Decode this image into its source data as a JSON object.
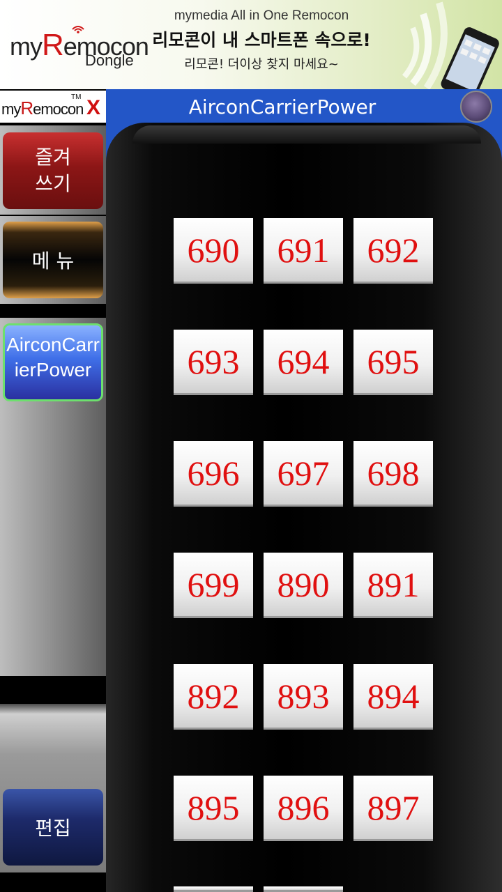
{
  "banner": {
    "logo_prefix": "my",
    "logo_r": "R",
    "logo_rest": "emocon",
    "logo_sub": "Dongle",
    "line1": "mymedia All in One Remocon",
    "line2": "리모콘이 내 스마트폰 속으로!",
    "line3": "리모콘! 더이상 찾지 마세요~"
  },
  "sidebar": {
    "logo_prefix": "my",
    "logo_r": "R",
    "logo_rest": "emocon",
    "logo_tm": "TM",
    "logo_x": "X",
    "favorites_label": "즐겨\n쓰기",
    "menu_label": "메 뉴",
    "current_label": "AirconCarrierPower",
    "edit_label": "편집"
  },
  "header": {
    "title": "AirconCarrierPower"
  },
  "keypad": {
    "rows": [
      [
        "690",
        "691",
        "692"
      ],
      [
        "693",
        "694",
        "695"
      ],
      [
        "696",
        "697",
        "698"
      ],
      [
        "699",
        "890",
        "891"
      ],
      [
        "892",
        "893",
        "894"
      ],
      [
        "895",
        "896",
        "897"
      ],
      [
        "",
        ""
      ]
    ]
  },
  "colors": {
    "header_blue": "#2356c7",
    "button_text_red": "#e01010",
    "current_border_green": "#6de06d"
  }
}
